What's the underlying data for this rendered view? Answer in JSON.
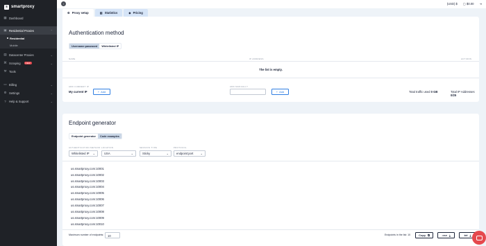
{
  "brand": {
    "name": "smartproxy"
  },
  "sidebar": {
    "items": [
      {
        "label": "Dashboard",
        "icon": "grid-icon"
      },
      {
        "label": "Residential Proxies",
        "icon": "residential-icon"
      },
      {
        "label": "Datacenter Proxies",
        "icon": "datacenter-icon"
      },
      {
        "label": "Scraping",
        "icon": "scraping-icon",
        "badge": "NEW"
      },
      {
        "label": "Tools",
        "icon": "tools-icon"
      },
      {
        "label": "Billing",
        "icon": "billing-icon"
      },
      {
        "label": "Settings",
        "icon": "settings-icon"
      },
      {
        "label": "Help & Support",
        "icon": "help-icon"
      }
    ],
    "sub_items": [
      {
        "label": "Residential"
      },
      {
        "label": "Mobile"
      }
    ]
  },
  "topbar": {
    "currency": "(USD) $",
    "balance": "$0.00"
  },
  "tabs": [
    {
      "label": "Proxy setup"
    },
    {
      "label": "Statistics"
    },
    {
      "label": "Pricing"
    }
  ],
  "auth": {
    "title": "Authentication method",
    "seg": [
      "Username:password",
      "Whitelisted IP"
    ],
    "columns": [
      "NAME",
      "IP ADDRESS",
      "ACTIONS"
    ],
    "empty": "The list is empty.",
    "add_current_label": "ADD CURRENT IP",
    "current_ip_label": "My current IP",
    "add_btn": "Add",
    "add_manually_label": "ADD MANUALLY",
    "add_btn2": "Add",
    "traffic_label": "Total traffic used",
    "traffic_value": "0 GB",
    "addresses_label": "Total IP Addresses",
    "addresses_value": "0/25"
  },
  "endpoint": {
    "title": "Endpoint generator",
    "seg": [
      "Endpoint generator",
      "Code examples"
    ],
    "filters": [
      {
        "label": "AUTHENTICATION METHOD",
        "value": "Whitelisted IP"
      },
      {
        "label": "LOCATION",
        "value": "USA"
      },
      {
        "label": "SESSION TYPE",
        "value": "Sticky"
      },
      {
        "label": "PROTOCOL",
        "value": "endpoint:port"
      }
    ],
    "endpoints": [
      "us.smartproxy.com:10001",
      "us.smartproxy.com:10002",
      "us.smartproxy.com:10003",
      "us.smartproxy.com:10004",
      "us.smartproxy.com:10005",
      "us.smartproxy.com:10006",
      "us.smartproxy.com:10007",
      "us.smartproxy.com:10008",
      "us.smartproxy.com:10009",
      "us.smartproxy.com:10010"
    ],
    "max_label": "Maximum number of endpoints:",
    "max_value": "10",
    "count_label": "Endpoints in the list:",
    "count_value": "10",
    "copy_btn": "Copy",
    "csv_btn": ".csv",
    "txt_btn": ".txt"
  },
  "colors": {
    "accent": "#2e7de1",
    "sidebar": "#1f2227",
    "chat": "#e5484d"
  }
}
